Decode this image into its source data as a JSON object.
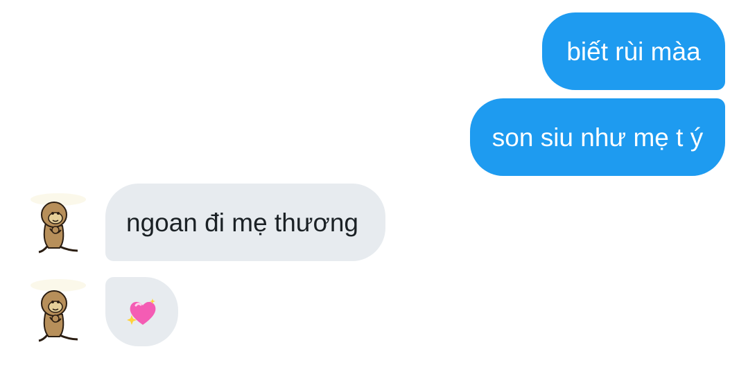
{
  "conversation": {
    "messages": [
      {
        "direction": "sent",
        "text": "biết rùi màa"
      },
      {
        "direction": "sent",
        "text": "son siu như mẹ t ý"
      },
      {
        "direction": "received",
        "text": "ngoan đi mẹ thương"
      },
      {
        "direction": "received",
        "emoji": "sparkling-heart"
      }
    ]
  },
  "colors": {
    "sent_bubble": "#1e9bf0",
    "received_bubble": "#e7ebef",
    "sent_text": "#ffffff",
    "received_text": "#1b2125"
  }
}
